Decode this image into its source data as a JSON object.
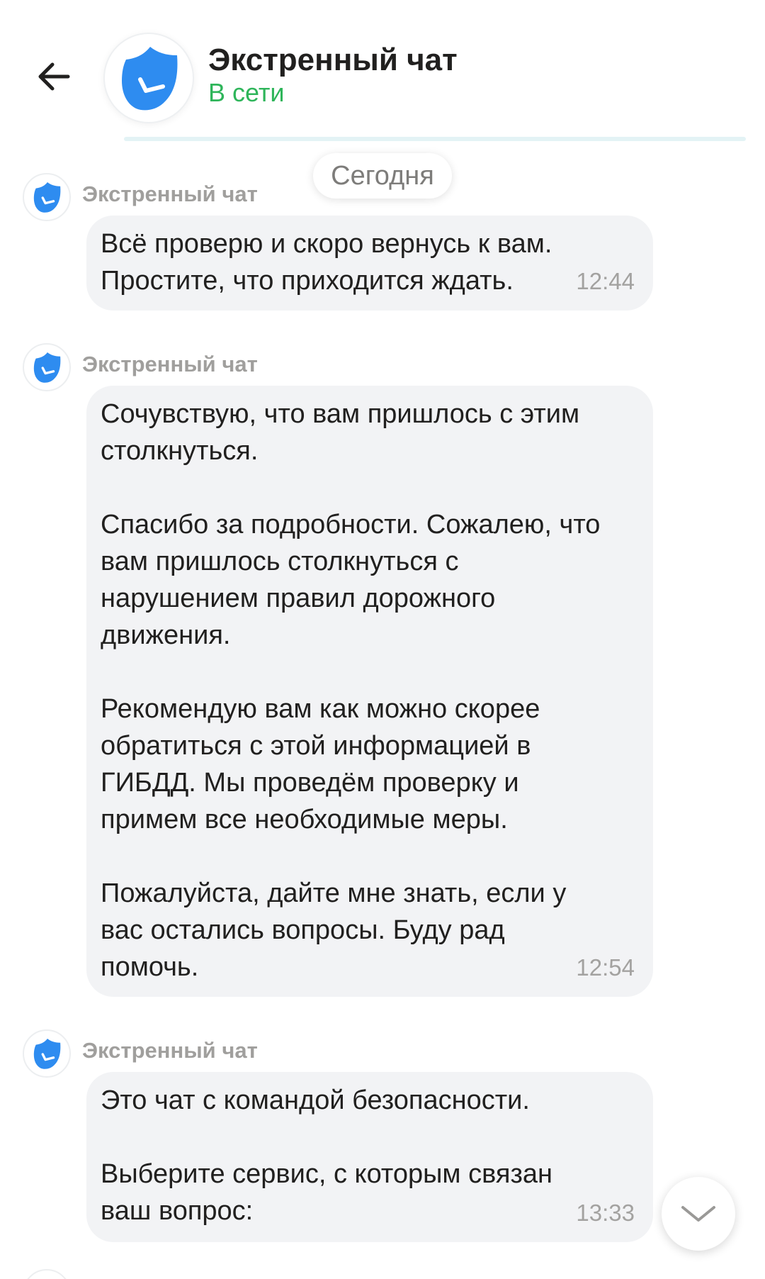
{
  "header": {
    "title": "Экстренный чат",
    "status": "В сети"
  },
  "date_separator": "Сегодня",
  "messages": [
    {
      "sender": "Экстренный чат",
      "text": "Всё проверю и скоро вернусь к вам.\nПростите, что приходится ждать.",
      "time": "12:44"
    },
    {
      "sender": "Экстренный чат",
      "text": "Сочувствую, что вам пришлось с этим\nстолкнуться.\n\nСпасибо за подробности. Сожалею, что\nвам пришлось столкнуться с\nнарушением правил дорожного\nдвижения.\n\nРекомендую вам как можно скорее\nобратиться с этой информацией в\nГИБДД. Мы проведём проверку и\nпримем все необходимые меры.\n\nПожалуйста, дайте мне знать, если у\nвас остались вопросы. Буду рад\nпомочь.",
      "time": "12:54"
    },
    {
      "sender": "Экстренный чат",
      "text": "Это чат с командой безопасности.\n\nВыберите сервис, с которым связан\nваш вопрос:",
      "time": "13:33"
    }
  ],
  "colors": {
    "online_status": "#2eb55a",
    "shield_blue": "#2e8cf0",
    "bubble_bg": "#f2f3f5",
    "time_gray": "#a3a2a0"
  },
  "icons": {
    "back": "arrow-left-icon",
    "avatar": "shield-check-icon",
    "scroll_down": "chevron-down-icon"
  }
}
